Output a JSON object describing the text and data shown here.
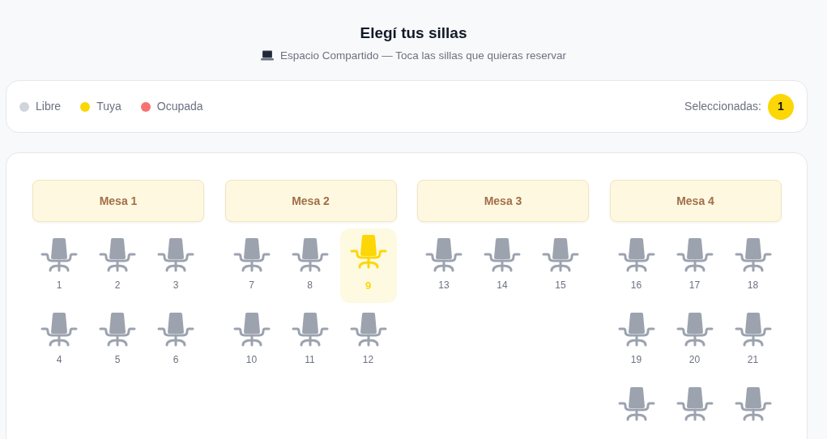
{
  "header": {
    "title": "Elegí tus sillas",
    "subtitle": "Espacio Compartido — Toca las sillas que quieras reservar"
  },
  "legend": [
    {
      "label": "Libre",
      "color": "#d1d5db"
    },
    {
      "label": "Tuya",
      "color": "#fcd705"
    },
    {
      "label": "Ocupada",
      "color": "#f87171"
    }
  ],
  "selected_count": {
    "label": "Seleccionadas:",
    "value": "1"
  },
  "tables": [
    {
      "name": "Mesa 1",
      "seats": [
        {
          "number": "1",
          "selected": false
        },
        {
          "number": "2",
          "selected": false
        },
        {
          "number": "3",
          "selected": false
        },
        {
          "number": "4",
          "selected": false
        },
        {
          "number": "5",
          "selected": false
        },
        {
          "number": "6",
          "selected": false
        }
      ]
    },
    {
      "name": "Mesa 2",
      "seats": [
        {
          "number": "7",
          "selected": false
        },
        {
          "number": "8",
          "selected": false
        },
        {
          "number": "9",
          "selected": true
        },
        {
          "number": "10",
          "selected": false
        },
        {
          "number": "11",
          "selected": false
        },
        {
          "number": "12",
          "selected": false
        }
      ]
    },
    {
      "name": "Mesa 3",
      "seats": [
        {
          "number": "13",
          "selected": false
        },
        {
          "number": "14",
          "selected": false
        },
        {
          "number": "15",
          "selected": false
        }
      ]
    },
    {
      "name": "Mesa 4",
      "seats": [
        {
          "number": "16",
          "selected": false
        },
        {
          "number": "17",
          "selected": false
        },
        {
          "number": "18",
          "selected": false
        },
        {
          "number": "19",
          "selected": false
        },
        {
          "number": "20",
          "selected": false
        },
        {
          "number": "21",
          "selected": false
        },
        {
          "selected": false
        },
        {
          "selected": false
        },
        {
          "selected": false
        }
      ]
    }
  ]
}
